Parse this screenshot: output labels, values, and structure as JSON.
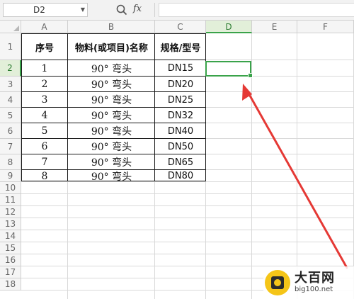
{
  "formula_bar": {
    "name_box": "D2",
    "fx_label": "fx",
    "formula": ""
  },
  "columns": [
    "A",
    "B",
    "C",
    "D",
    "E",
    "F"
  ],
  "active_column": "D",
  "rows": [
    "1",
    "2",
    "3",
    "4",
    "5",
    "6",
    "7",
    "8",
    "9",
    "10",
    "11",
    "12",
    "13",
    "14",
    "15",
    "16",
    "17",
    "18"
  ],
  "active_row": "2",
  "table": {
    "headers": [
      "序号",
      "物料(或项目)名称",
      "规格/型号"
    ],
    "records": [
      [
        "1",
        "90° 弯头",
        "DN15"
      ],
      [
        "2",
        "90° 弯头",
        "DN20"
      ],
      [
        "3",
        "90° 弯头",
        "DN25"
      ],
      [
        "4",
        "90° 弯头",
        "DN32"
      ],
      [
        "5",
        "90° 弯头",
        "DN40"
      ],
      [
        "6",
        "90° 弯头",
        "DN50"
      ],
      [
        "7",
        "90° 弯头",
        "DN65"
      ],
      [
        "8",
        "90° 弯头",
        "DN80"
      ]
    ]
  },
  "watermark": {
    "title": "大百网",
    "url": "big100.net"
  },
  "colors": {
    "accent": "#3aa34a",
    "arrow": "#e53935",
    "grid": "#d9d9d9"
  }
}
